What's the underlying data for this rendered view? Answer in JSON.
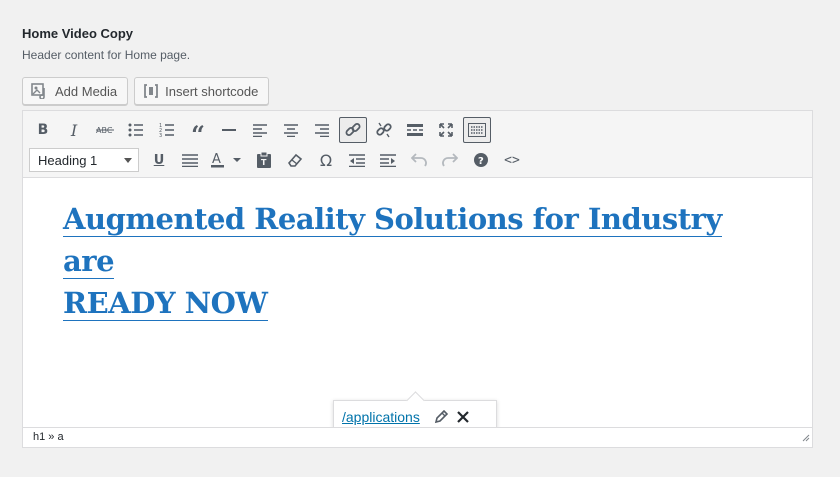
{
  "field": {
    "title": "Home Video Copy",
    "description": "Header content for Home page."
  },
  "media_buttons": {
    "add_media": "Add Media",
    "insert_shortcode": "Insert shortcode"
  },
  "toolbar": {
    "format_select": "Heading 1",
    "row1_icons": [
      "bold-icon",
      "italic-icon",
      "strikethrough-icon",
      "bullet-list-icon",
      "numbered-list-icon",
      "blockquote-icon",
      "horizontal-line-icon",
      "align-left-icon",
      "align-center-icon",
      "align-right-icon",
      "insert-link-icon",
      "remove-link-icon",
      "read-more-icon",
      "fullscreen-icon",
      "toolbar-toggle-icon"
    ],
    "row2_icons": [
      "format-select",
      "underline-icon",
      "justify-icon",
      "text-color-icon",
      "paste-text-icon",
      "clear-formatting-icon",
      "special-character-icon",
      "outdent-icon",
      "indent-icon",
      "undo-icon",
      "redo-icon",
      "help-icon",
      "code-icon"
    ],
    "active": [
      "insert-link-icon",
      "toolbar-toggle-icon"
    ],
    "disabled": [
      "undo-icon",
      "redo-icon"
    ]
  },
  "content": {
    "heading_line1": "Augmented Reality Solutions for Industry",
    "heading_line2": "are",
    "heading_line3": "READY NOW",
    "link_color": "#1e73be"
  },
  "link_popup": {
    "url": "/applications"
  },
  "statusbar": {
    "path": "h1 » a"
  }
}
